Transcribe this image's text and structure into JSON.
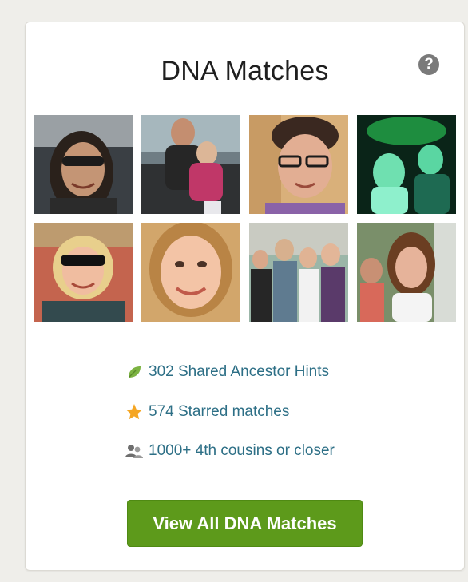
{
  "widget": {
    "title": "DNA Matches",
    "help_icon": "question-circle-icon",
    "help_glyph": "?"
  },
  "photos": [
    {
      "subject": "woman with sunglasses on head"
    },
    {
      "subject": "man hugging young girl"
    },
    {
      "subject": "person with glasses"
    },
    {
      "subject": "couple at party in green light"
    },
    {
      "subject": "woman with sunglasses"
    },
    {
      "subject": "smiling blonde woman"
    },
    {
      "subject": "group of people posing"
    },
    {
      "subject": "two women outdoors"
    }
  ],
  "stats": [
    {
      "icon": "leaf-icon",
      "label": "302 Shared Ancestor Hints",
      "color": "#7cb342"
    },
    {
      "icon": "star-icon",
      "label": "574 Starred matches",
      "color": "#f5a623"
    },
    {
      "icon": "people-icon",
      "label": "1000+ 4th cousins or closer",
      "color": "#6e6e6e"
    }
  ],
  "button": {
    "label": "View All DNA Matches",
    "color": "#5d9a1b"
  }
}
